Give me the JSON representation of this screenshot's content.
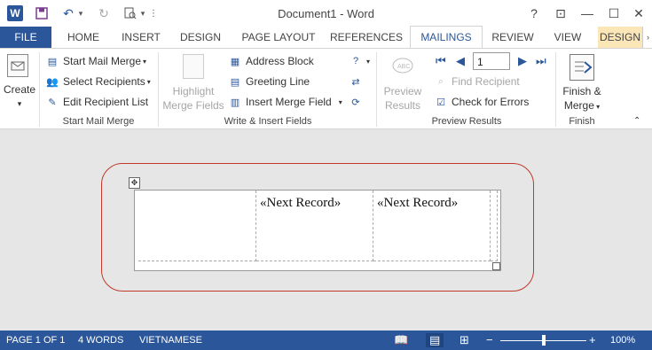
{
  "titlebar": {
    "title": "Document1 - Word",
    "app_icon_letter": "W",
    "help": "?",
    "restore_ribbon": "⊡",
    "minimize": "—",
    "maximize": "☐",
    "close": "✕"
  },
  "tabs": [
    {
      "label": "FILE"
    },
    {
      "label": "HOME"
    },
    {
      "label": "INSERT"
    },
    {
      "label": "DESIGN"
    },
    {
      "label": "PAGE LAYOUT"
    },
    {
      "label": "REFERENCES"
    },
    {
      "label": "MAILINGS"
    },
    {
      "label": "REVIEW"
    },
    {
      "label": "VIEW"
    },
    {
      "label": "DESIGN"
    }
  ],
  "ribbon": {
    "create": {
      "label": "Create"
    },
    "start_mail_merge": {
      "start": "Start Mail Merge",
      "select": "Select Recipients",
      "edit": "Edit Recipient List",
      "group": "Start Mail Merge"
    },
    "write_insert": {
      "highlight_line1": "Highlight",
      "highlight_line2": "Merge Fields",
      "address": "Address Block",
      "greeting": "Greeting Line",
      "insert_field": "Insert Merge Field",
      "group": "Write & Insert Fields"
    },
    "preview": {
      "preview_line1": "Preview",
      "preview_line2": "Results",
      "record_number": "1",
      "find": "Find Recipient",
      "check": "Check for Errors",
      "group": "Preview Results"
    },
    "finish": {
      "line1": "Finish &",
      "line2": "Merge",
      "group": "Finish"
    }
  },
  "document": {
    "cells": [
      "",
      "«Next Record»",
      "«Next Record»",
      ""
    ]
  },
  "status": {
    "page": "PAGE 1 OF 1",
    "words": "4 WORDS",
    "language": "VIETNAMESE",
    "zoom": "100%",
    "zoom_level": 0.5
  },
  "colors": {
    "accent": "#2b579a",
    "highlight_outline": "#c0392b",
    "user_tab": "#fbe6b8"
  }
}
